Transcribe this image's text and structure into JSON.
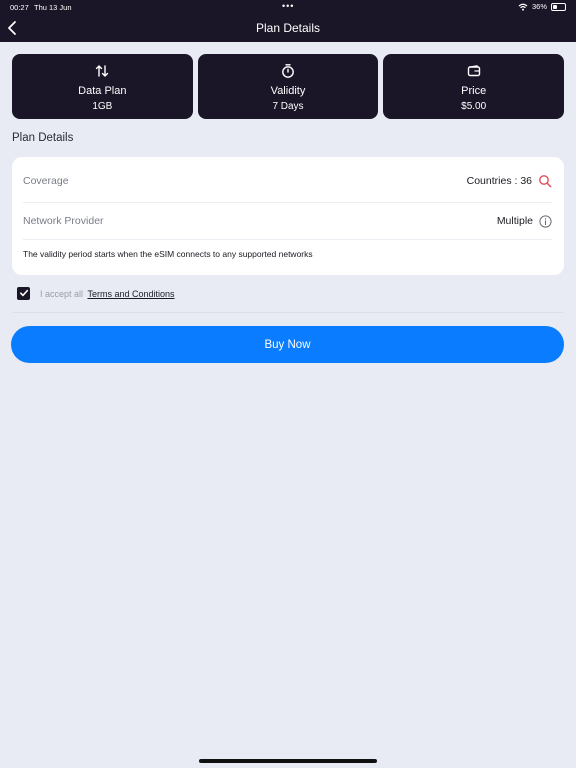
{
  "status_bar": {
    "time": "00:27",
    "date": "Thu 13 Jun",
    "dots": "•••",
    "battery": "36%",
    "battery_level": 0.36
  },
  "header": {
    "title": "Plan Details",
    "background": "#1b1627"
  },
  "summary_cards": [
    {
      "icon": "up-down-arrows-icon",
      "title": "Data Plan",
      "value": "1GB"
    },
    {
      "icon": "stopwatch-icon",
      "title": "Validity",
      "value": "7 Days"
    },
    {
      "icon": "wallet-icon",
      "title": "Price",
      "value": "$5.00"
    }
  ],
  "section_title": "Plan Details",
  "details": {
    "coverage_label": "Coverage",
    "coverage_value": "Countries : 36",
    "provider_label": "Network Provider",
    "provider_value": "Multiple",
    "note": "The validity period starts when the eSIM connects to any supported networks"
  },
  "terms": {
    "checked": true,
    "prefix": "I accept all",
    "link": "Terms and Conditions"
  },
  "buy_button": {
    "label": "Buy Now",
    "color": "#0a7cff"
  },
  "colors": {
    "accent": "#0a7cff",
    "dark": "#1b1627",
    "background": "#e8ebf3",
    "search_icon": "#e0505a"
  }
}
